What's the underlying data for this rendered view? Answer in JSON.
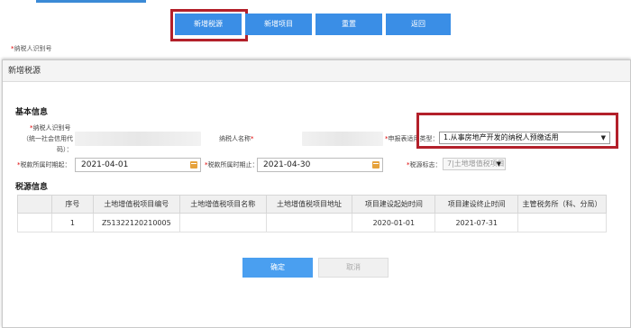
{
  "toolbar": {
    "add_tax_source": "新增税源",
    "add_project": "新增项目",
    "reset": "重置",
    "back": "返回"
  },
  "background": {
    "taxpayer_id_label": "纳税人识别号"
  },
  "modal": {
    "title": "新增税源",
    "basic_info": {
      "section_title": "基本信息",
      "taxpayer_id_label_line1": "纳税人识别号",
      "taxpayer_id_label_line2": "（统一社会信用代",
      "taxpayer_id_label_line3": "码）：",
      "taxpayer_name_label": "纳税人名称",
      "report_type_label": "申报表适用类型：",
      "report_type_value": "1.从事房地产开发的纳税人预缴适用",
      "period_start_label": "税款所属时期起：",
      "period_start_value": "2021-04-01",
      "period_end_label": "税款所属时期止：",
      "period_end_value": "2021-04-30",
      "source_flag_label": "税源标志：",
      "source_flag_value": "7|土地增值税项目"
    },
    "tax_source": {
      "section_title": "税源信息",
      "headers": [
        "序号",
        "土地增值税项目编号",
        "土地增值税项目名称",
        "土地增值税项目地址",
        "项目建设起始时间",
        "项目建设终止时间",
        "主管税务所（科、分局）"
      ],
      "rows": [
        [
          "1",
          "Z51322120210005",
          "",
          "",
          "2020-01-01",
          "2021-07-31",
          ""
        ]
      ]
    },
    "confirm": "确定",
    "cancel": "取消"
  },
  "colors": {
    "primary_button": "#3a8ee6",
    "highlight_box": "#b3202a"
  }
}
